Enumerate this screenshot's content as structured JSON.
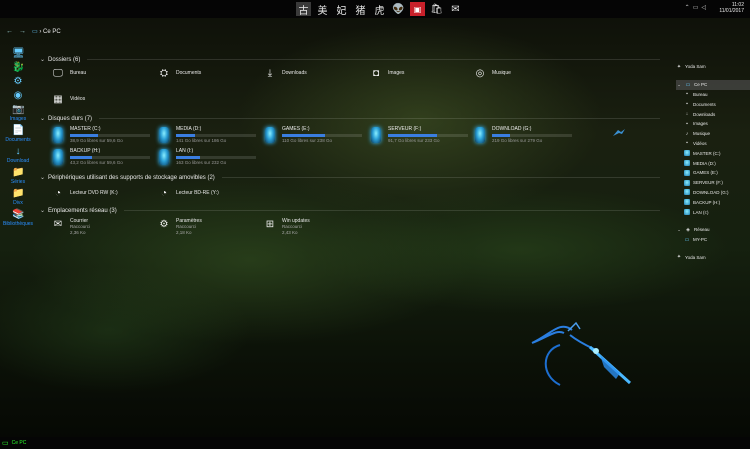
{
  "taskbar": {
    "pinned": [
      {
        "icon": "calligraphy-icon",
        "glyph": "古",
        "selected": true
      },
      {
        "icon": "calligraphy-icon",
        "glyph": "美",
        "selected": false
      },
      {
        "icon": "calligraphy-icon",
        "glyph": "妃",
        "selected": false
      },
      {
        "icon": "calligraphy-icon",
        "glyph": "猪",
        "selected": false
      },
      {
        "icon": "calligraphy-icon",
        "glyph": "虎",
        "selected": false
      },
      {
        "icon": "alien-icon",
        "glyph": "👽",
        "selected": false
      },
      {
        "icon": "office-icon",
        "glyph": "▣",
        "selected": false
      },
      {
        "icon": "store-icon",
        "glyph": "🛍",
        "selected": false
      },
      {
        "icon": "mail-icon",
        "glyph": "✉",
        "selected": false
      }
    ],
    "clock_time": "11:02",
    "clock_date": "11/01/2017"
  },
  "nav": {
    "back": "←",
    "forward": "→",
    "breadcrumb_root": "Ce PC"
  },
  "leftbar": [
    {
      "icon": "computer-icon",
      "glyph": "🖥",
      "label": ""
    },
    {
      "icon": "dragon-icon",
      "glyph": "🐉",
      "label": ""
    },
    {
      "icon": "network-icon",
      "glyph": "⚙",
      "label": ""
    },
    {
      "icon": "shield-icon",
      "glyph": "◉",
      "label": ""
    },
    {
      "icon": "images-icon",
      "glyph": "📷",
      "label": "Images"
    },
    {
      "icon": "documents-icon",
      "glyph": "📄",
      "label": "Documents"
    },
    {
      "icon": "download-icon",
      "glyph": "↓",
      "label": "Download"
    },
    {
      "icon": "folder-icon",
      "glyph": "📁",
      "label": "Séries"
    },
    {
      "icon": "folder-icon",
      "glyph": "📁",
      "label": "Divx"
    },
    {
      "icon": "libraries-icon",
      "glyph": "📚",
      "label": "Bibliothèques"
    }
  ],
  "groups": {
    "folders": "Dossiers (6)",
    "drives": "Disques durs (7)",
    "periph": "Périphériques utilisant des supports de stockage amovibles (2)",
    "network": "Emplacements réseau (3)"
  },
  "folders": [
    {
      "icon": "desktop-icon",
      "glyph": "🖵",
      "name": "Bureau"
    },
    {
      "icon": "documents-icon",
      "glyph": "⛭",
      "name": "Documents"
    },
    {
      "icon": "download-icon",
      "glyph": "⤓",
      "name": "Downloads"
    },
    {
      "icon": "camera-icon",
      "glyph": "◘",
      "name": "Images"
    },
    {
      "icon": "music-icon",
      "glyph": "◎",
      "name": "Musique"
    },
    {
      "icon": "video-icon",
      "glyph": "▦",
      "name": "Vidéos"
    }
  ],
  "drives": [
    {
      "name": "MASTER (C:)",
      "free": "38,9 Go libres sur 59,6 Go",
      "used": 0.35
    },
    {
      "name": "MEDIA (D:)",
      "free": "141 Go libres sur 186 Go",
      "used": 0.24
    },
    {
      "name": "GAMES (E:)",
      "free": "110 Go libres sur 238 Go",
      "used": 0.54
    },
    {
      "name": "SERVEUR (F:)",
      "free": "91,7 Go libres sur 233 Go",
      "used": 0.61
    },
    {
      "name": "DOWNLOAD (G:)",
      "free": "219 Go libres sur 279 Go",
      "used": 0.22
    },
    {
      "name": "BACKUP (H:)",
      "free": "43,2 Go libres sur 59,6 Go",
      "used": 0.28
    },
    {
      "name": "LAN (I:)",
      "free": "163 Go libres sur 232 Go",
      "used": 0.3
    }
  ],
  "periph": [
    {
      "icon": "dvd-icon",
      "glyph": "◔",
      "name": "Lecteur DVD RW (K:)"
    },
    {
      "icon": "dvd-icon",
      "glyph": "◔",
      "name": "Lecteur BD-RE (Y:)"
    }
  ],
  "network": [
    {
      "icon": "mail-icon",
      "glyph": "✉",
      "name": "Courrier",
      "type": "Raccourci",
      "size": "2,36 Ko"
    },
    {
      "icon": "gear-icon",
      "glyph": "⚙",
      "name": "Paramètres",
      "type": "Raccourci",
      "size": "2,18 Ko"
    },
    {
      "icon": "windows-update-icon",
      "glyph": "⊞",
      "name": "Win updates",
      "type": "Raccourci",
      "size": "2,43 Ko"
    }
  ],
  "rightpane": {
    "top_user": "Yoda Sam",
    "this_pc": "Ce PC",
    "items": [
      {
        "icon": "desktop-icon",
        "glyph": "▪",
        "label": "Bureau",
        "drive": false
      },
      {
        "icon": "documents-icon",
        "glyph": "▪",
        "label": "Documents",
        "drive": false
      },
      {
        "icon": "download-icon",
        "glyph": "↓",
        "label": "Downloads",
        "drive": false
      },
      {
        "icon": "images-icon",
        "glyph": "▪",
        "label": "Images",
        "drive": false
      },
      {
        "icon": "music-icon",
        "glyph": "♪",
        "label": "Musique",
        "drive": false
      },
      {
        "icon": "video-icon",
        "glyph": "▪",
        "label": "Vidéos",
        "drive": false
      },
      {
        "icon": "drive-icon",
        "glyph": "",
        "label": "MASTER (C:)",
        "drive": true
      },
      {
        "icon": "drive-icon",
        "glyph": "",
        "label": "MEDIA (D:)",
        "drive": true
      },
      {
        "icon": "drive-icon",
        "glyph": "",
        "label": "GAMES (E:)",
        "drive": true
      },
      {
        "icon": "drive-icon",
        "glyph": "",
        "label": "SERVEUR (F:)",
        "drive": true
      },
      {
        "icon": "drive-icon",
        "glyph": "",
        "label": "DOWNLOAD (G:)",
        "drive": true
      },
      {
        "icon": "drive-icon",
        "glyph": "",
        "label": "BACKUP (H:)",
        "drive": true
      },
      {
        "icon": "drive-icon",
        "glyph": "",
        "label": "LAN (I:)",
        "drive": true
      }
    ],
    "network": "Réseau",
    "network_child": "MY-PC",
    "bottom_user": "Yoda Sam"
  },
  "statusbar": {
    "label": "Ce PC"
  }
}
